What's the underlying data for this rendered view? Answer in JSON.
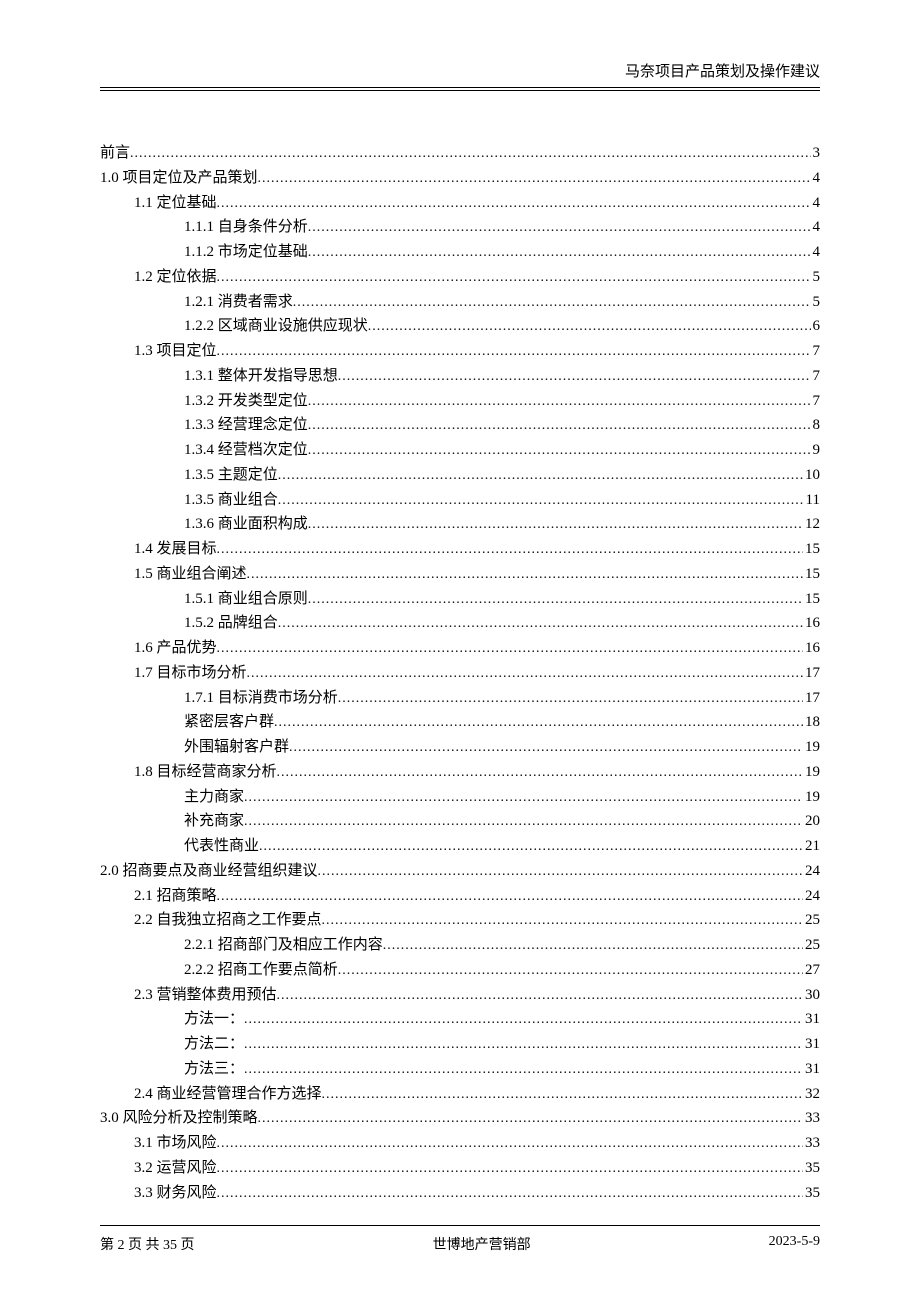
{
  "header": {
    "title": "马奈项目产品策划及操作建议"
  },
  "toc": [
    {
      "level": 0,
      "label": "前言",
      "page": "3"
    },
    {
      "level": 0,
      "label": "1.0  项目定位及产品策划",
      "page": "4"
    },
    {
      "level": 1,
      "label": "1.1 定位基础",
      "page": "4"
    },
    {
      "level": 2,
      "label": "1.1.1 自身条件分析",
      "page": "4"
    },
    {
      "level": 2,
      "label": "1.1.2 市场定位基础",
      "page": "4"
    },
    {
      "level": 1,
      "label": "1.2 定位依据",
      "page": "5"
    },
    {
      "level": 2,
      "label": "1.2.1 消费者需求",
      "page": "5"
    },
    {
      "level": 2,
      "label": "1.2.2 区域商业设施供应现状",
      "page": "6"
    },
    {
      "level": 1,
      "label": "1.3 项目定位",
      "page": "7"
    },
    {
      "level": 2,
      "label": "1.3.1 整体开发指导思想",
      "page": "7"
    },
    {
      "level": 2,
      "label": "1.3.2 开发类型定位",
      "page": "7"
    },
    {
      "level": 2,
      "label": "1.3.3 经营理念定位",
      "page": "8"
    },
    {
      "level": 2,
      "label": "1.3.4 经营档次定位",
      "page": "9"
    },
    {
      "level": 2,
      "label": "1.3.5 主题定位",
      "page": "10"
    },
    {
      "level": 2,
      "label": "1.3.5  商业组合",
      "page": "11"
    },
    {
      "level": 2,
      "label": "1.3.6  商业面积构成",
      "page": "12"
    },
    {
      "level": 1,
      "label": "1.4 发展目标",
      "page": "15"
    },
    {
      "level": 1,
      "label": "1.5 商业组合阐述",
      "page": "15"
    },
    {
      "level": 2,
      "label": "1.5.1 商业组合原则",
      "page": "15"
    },
    {
      "level": 2,
      "label": "1.5.2 品牌组合",
      "page": "16"
    },
    {
      "level": 1,
      "label": "1.6 产品优势",
      "page": "16"
    },
    {
      "level": 1,
      "label": "1.7  目标市场分析",
      "page": "17"
    },
    {
      "level": 2,
      "label": "1.7.1 目标消费市场分析",
      "page": "17"
    },
    {
      "level": 2,
      "label": "紧密层客户群",
      "page": "18"
    },
    {
      "level": 2,
      "label": "外围辐射客户群",
      "page": "19"
    },
    {
      "level": 1,
      "label": "1.8 目标经营商家分析",
      "page": "19"
    },
    {
      "level": 2,
      "label": "主力商家",
      "page": "19"
    },
    {
      "level": 2,
      "label": "补充商家",
      "page": "20"
    },
    {
      "level": 2,
      "label": "代表性商业",
      "page": "21"
    },
    {
      "level": 0,
      "label": "2.0  招商要点及商业经营组织建议",
      "page": "24"
    },
    {
      "level": 1,
      "label": "2.1 招商策略",
      "page": "24"
    },
    {
      "level": 1,
      "label": "2.2 自我独立招商之工作要点",
      "page": "25"
    },
    {
      "level": 2,
      "label": "2.2.1 招商部门及相应工作内容",
      "page": "25"
    },
    {
      "level": 2,
      "label": "2.2.2 招商工作要点简析",
      "page": "27"
    },
    {
      "level": 1,
      "label": "2.3 营销整体费用预估",
      "page": "30"
    },
    {
      "level": 2,
      "label": "方法一：",
      "page": "31"
    },
    {
      "level": 2,
      "label": "方法二：",
      "page": "31"
    },
    {
      "level": 2,
      "label": "方法三：",
      "page": "31"
    },
    {
      "level": 1,
      "label": "2.4 商业经营管理合作方选择",
      "page": "32"
    },
    {
      "level": 0,
      "label": "3.0  风险分析及控制策略",
      "page": "33"
    },
    {
      "level": 1,
      "label": "3.1 市场风险",
      "page": "33"
    },
    {
      "level": 1,
      "label": "3.2 运营风险",
      "page": "35"
    },
    {
      "level": 1,
      "label": "3.3 财务风险",
      "page": "35"
    }
  ],
  "footer": {
    "left": "第 2 页 共 35 页",
    "center": "世博地产营销部",
    "right": "2023-5-9"
  }
}
